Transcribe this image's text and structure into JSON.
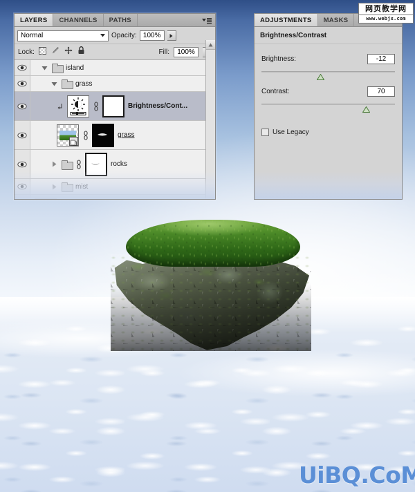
{
  "layers_panel": {
    "tabs": [
      {
        "label": "LAYERS",
        "active": true
      },
      {
        "label": "CHANNELS",
        "active": false
      },
      {
        "label": "PATHS",
        "active": false
      }
    ],
    "menu_icon": "panel-menu-icon",
    "blend_mode": "Normal",
    "opacity_label": "Opacity:",
    "opacity_value": "100%",
    "lock_label": "Lock:",
    "lock_icons": [
      "transparency-lock-icon",
      "brush-lock-icon",
      "move-lock-icon",
      "all-lock-icon"
    ],
    "fill_label": "Fill:",
    "fill_value": "100%",
    "rows": [
      {
        "name": "island",
        "type": "group",
        "expanded": true,
        "indent": 0,
        "visible": true,
        "selected": false
      },
      {
        "name": "grass",
        "type": "group",
        "expanded": true,
        "indent": 1,
        "visible": true,
        "selected": false
      },
      {
        "name": "Brightness/Cont...",
        "type": "adjustment",
        "indent": 2,
        "visible": true,
        "selected": true,
        "clipped": true,
        "linked": true
      },
      {
        "name": "grass",
        "type": "smart-object",
        "indent": 2,
        "visible": true,
        "selected": false,
        "linked": true
      },
      {
        "name": "rocks",
        "type": "group",
        "expanded": false,
        "indent": 1,
        "visible": true,
        "selected": false,
        "linked": true
      },
      {
        "name": "mist",
        "type": "group",
        "expanded": false,
        "indent": 1,
        "visible": true,
        "selected": false
      }
    ]
  },
  "adjustments_panel": {
    "tabs": [
      {
        "label": "ADJUSTMENTS",
        "active": true
      },
      {
        "label": "MASKS",
        "active": false
      }
    ],
    "title": "Brightness/Contrast",
    "brightness_label": "Brightness:",
    "brightness_value": "-12",
    "brightness_slider_pct": 44,
    "contrast_label": "Contrast:",
    "contrast_value": "70",
    "contrast_slider_pct": 78,
    "use_legacy_label": "Use Legacy",
    "use_legacy_checked": false
  },
  "watermarks": {
    "top_cn": "网页教学网",
    "top_url": "www.webjx.com",
    "bottom": "UiBQ.CoM"
  },
  "artwork": {
    "name": "floating-grass-island-over-clouds",
    "grass_color": "#4c8a28",
    "rock_color": "#59624c",
    "sky_top_color": "#2f4f87",
    "cloud_color": "#e2eaf5"
  }
}
